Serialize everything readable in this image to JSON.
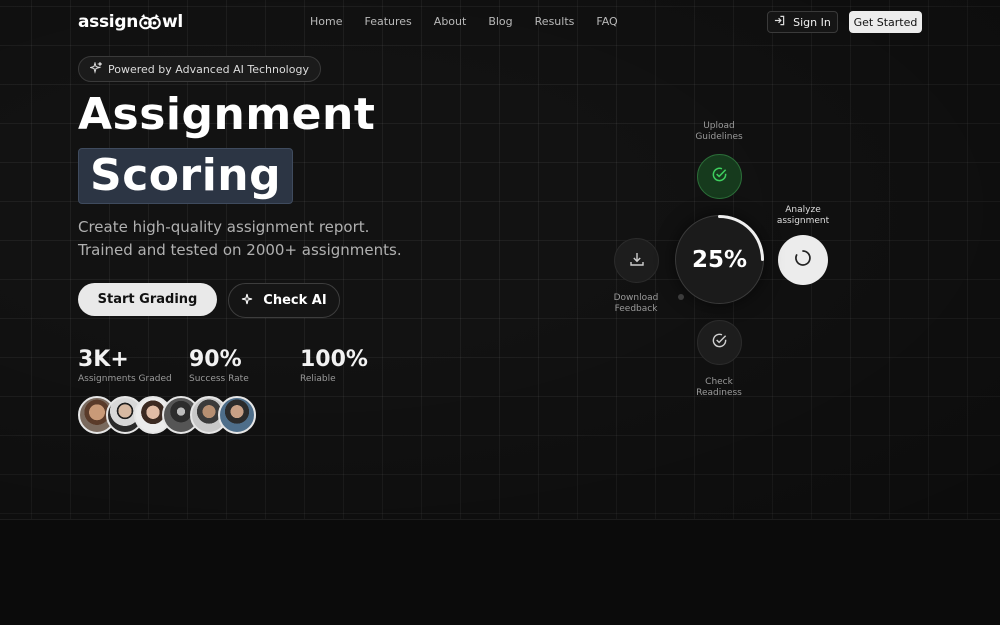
{
  "nav": {
    "logo_prefix": "assign",
    "logo_suffix": "wl",
    "links": [
      "Home",
      "Features",
      "About",
      "Blog",
      "Results",
      "FAQ"
    ],
    "sign_in": "Sign In",
    "get_started": "Get Started"
  },
  "hero": {
    "badge": "Powered by Advanced AI Technology",
    "title_line1": "Assignment",
    "title_line2": "Scoring",
    "description": "Create high-quality assignment report. Trained and tested on 2000+ assignments.",
    "primary_button": "Start Grading",
    "secondary_button": "Check AI"
  },
  "stats": [
    {
      "value": "3K+",
      "label": "Assignments Graded"
    },
    {
      "value": "90%",
      "label": "Success Rate"
    },
    {
      "value": "100%",
      "label": "Reliable"
    }
  ],
  "workflow": {
    "progress": "25%",
    "progress_fraction": 0.25,
    "upload_label": [
      "Upload",
      "Guidelines"
    ],
    "analyze_label": [
      "Analyze",
      "assignment"
    ],
    "download_label": [
      "Download",
      "Feedback"
    ],
    "check_label": [
      "Check",
      "Readiness"
    ]
  },
  "colors": {
    "accent_green": "#3ecf5e",
    "highlight_bg": "#2c3544",
    "primary_button_bg": "#e9e9e9"
  },
  "icons": {
    "badge": "sparkles-icon",
    "sign_in": "login-icon",
    "check_ai": "sparkle-icon",
    "upload": "check-circle-icon",
    "download": "download-icon",
    "check": "check-circle-icon",
    "analyze": "spinner-icon"
  }
}
